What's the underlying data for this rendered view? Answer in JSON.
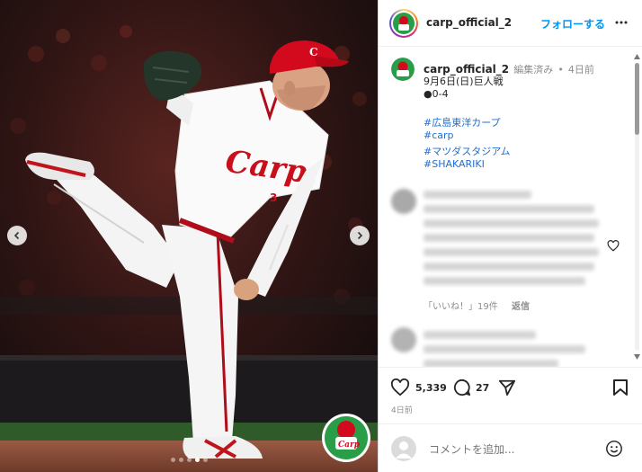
{
  "post": {
    "username": "carp_official_2",
    "follow_label": "フォローする",
    "more_label": "…",
    "caption": {
      "username": "carp_official_2",
      "edited": "編集済み",
      "separator": "•",
      "time": "4日前",
      "line1": "9月6日(日)巨人戦",
      "line2": "●0-4",
      "hashtags": [
        "#広島東洋カープ",
        "#carp",
        "#マツダスタジアム",
        "#SHAKARIKI"
      ]
    },
    "comments": [
      {
        "likes_label": "「いいね！」19件",
        "reply_label": "返信"
      }
    ],
    "actions": {
      "likes": "5,339",
      "comments": "27",
      "ago": "4日前"
    },
    "comment_placeholder": "コメントを追加...",
    "colors": {
      "accent": "#0095f6",
      "carp_red": "#d3091e",
      "hashtag": "#1d6fd6"
    },
    "icons": {
      "heart": "heart-icon",
      "comment": "comment-icon",
      "share": "share-icon",
      "bookmark": "bookmark-icon",
      "emoji": "emoji-icon",
      "more": "more-icon"
    },
    "carousel": {
      "slides": 5,
      "current": 4
    }
  }
}
